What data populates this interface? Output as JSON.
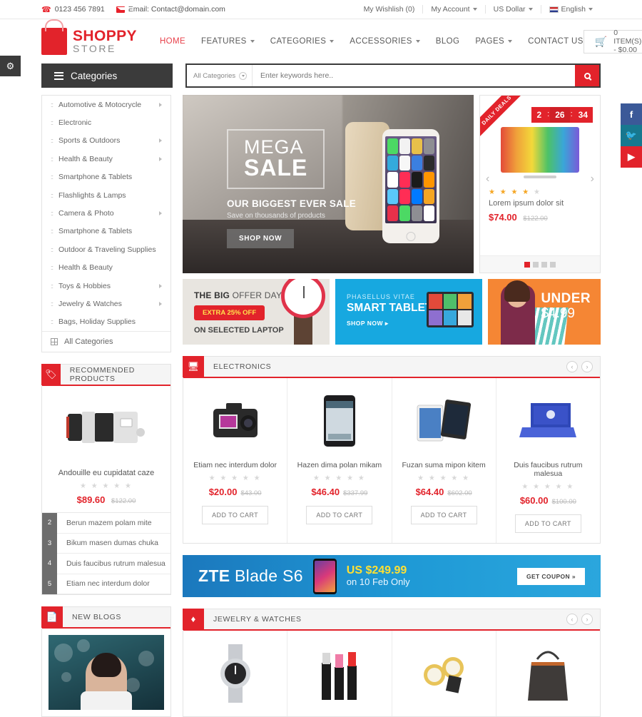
{
  "topbar": {
    "phone": "0123 456 7891",
    "email": "Email: Contact@domain.com",
    "wishlist": "My Wishlish (0)",
    "account": "My Account",
    "currency": "US Dollar",
    "language": "English"
  },
  "header": {
    "logo_main": "SHOPPY",
    "logo_sub": "STORE",
    "nav": [
      {
        "label": "HOME",
        "active": true,
        "caret": false
      },
      {
        "label": "FEATURES",
        "active": false,
        "caret": true
      },
      {
        "label": "CATEGORIES",
        "active": false,
        "caret": true
      },
      {
        "label": "ACCESSORIES",
        "active": false,
        "caret": true
      },
      {
        "label": "BLOG",
        "active": false,
        "caret": false
      },
      {
        "label": "PAGES",
        "active": false,
        "caret": true
      },
      {
        "label": "CONTACT US",
        "active": false,
        "caret": false
      }
    ],
    "cart": "0 ITEM(S) - $0.00"
  },
  "search": {
    "categories_button": "Categories",
    "select_value": "All Categories",
    "placeholder": "Enter keywords here.."
  },
  "categories": {
    "items": [
      {
        "label": "Automotive & Motocrycle",
        "arrow": true
      },
      {
        "label": "Electronic",
        "arrow": false
      },
      {
        "label": "Sports & Outdoors",
        "arrow": true
      },
      {
        "label": "Health & Beauty",
        "arrow": true
      },
      {
        "label": "Smartphone & Tablets",
        "arrow": false
      },
      {
        "label": "Flashlights & Lamps",
        "arrow": false
      },
      {
        "label": "Camera & Photo",
        "arrow": true
      },
      {
        "label": "Smartphone & Tablets",
        "arrow": false
      },
      {
        "label": "Outdoor & Traveling Supplies",
        "arrow": false
      },
      {
        "label": "Health & Beauty",
        "arrow": false
      },
      {
        "label": "Toys & Hobbies",
        "arrow": true
      },
      {
        "label": "Jewelry & Watches",
        "arrow": true
      },
      {
        "label": "Bags, Holiday Supplies",
        "arrow": false
      }
    ],
    "all": "All Categories"
  },
  "hero": {
    "mega": "MEGA",
    "sale": "SALE",
    "headline": "OUR BIGGEST EVER SALE",
    "sub": "Save on thousands of products",
    "cta": "SHOP NOW"
  },
  "deals": {
    "ribbon": "DAILY DEALS",
    "timer": {
      "hours": "2",
      "minutes": "26",
      "seconds": "34"
    },
    "name": "Lorem ipsum dolor sit",
    "price": "$74.00",
    "old_price": "$122.00",
    "rating": 4,
    "dots": 4,
    "active_dot": 0
  },
  "promos": {
    "p1": {
      "line1_bold": "THE BIG",
      "line1_rest": " OFFER DAY",
      "badge": "EXTRA 25% OFF",
      "line2": "ON SELECTED LAPTOP"
    },
    "p2": {
      "eyebrow": "PHASELLUS VITAE",
      "title": "SMART TABLET",
      "cta": "SHOP NOW ▸"
    },
    "p3": {
      "line1": "UNDER",
      "line2": "$4.99"
    }
  },
  "recommended": {
    "title": "RECOMMENDED PRODUCTS",
    "featured": {
      "name": "Andouille eu cupidatat caze",
      "price": "$89.60",
      "old_price": "$122.00",
      "rating": 0
    },
    "list": [
      {
        "num": "2",
        "label": "Berun mazem polam mite"
      },
      {
        "num": "3",
        "label": "Bikum masen dumas chuka"
      },
      {
        "num": "4",
        "label": "Duis faucibus rutrum malesua"
      },
      {
        "num": "5",
        "label": "Etiam nec interdum dolor"
      }
    ]
  },
  "electronics": {
    "title": "ELECTRONICS",
    "products": [
      {
        "name": "Etiam nec interdum dolor",
        "price": "$20.00",
        "old_price": "$43.00",
        "cta": "ADD TO CART",
        "rating": 0
      },
      {
        "name": "Hazen dima polan mikam",
        "price": "$46.40",
        "old_price": "$337.99",
        "cta": "ADD TO CART",
        "rating": 0
      },
      {
        "name": "Fuzan suma mipon kitem",
        "price": "$64.40",
        "old_price": "$602.00",
        "cta": "ADD TO CART",
        "rating": 0
      },
      {
        "name": "Duis faucibus rutrum malesua",
        "price": "$60.00",
        "old_price": "$100.00",
        "cta": "ADD TO CART",
        "rating": 0
      }
    ]
  },
  "zte": {
    "brand_bold": "ZTE",
    "brand_rest": " Blade S6",
    "price": "US $249.99",
    "sub": "on 10 Feb Only",
    "cta": "GET COUPON »"
  },
  "blogs": {
    "title": "NEW BLOGS"
  },
  "jewelry": {
    "title": "JEWELRY & WATCHES"
  },
  "colors": {
    "accent": "#e2232b",
    "dark": "#3b3b3b",
    "facebook": "#3b5998",
    "twitter": "#17788f",
    "youtube": "#e2232b"
  }
}
